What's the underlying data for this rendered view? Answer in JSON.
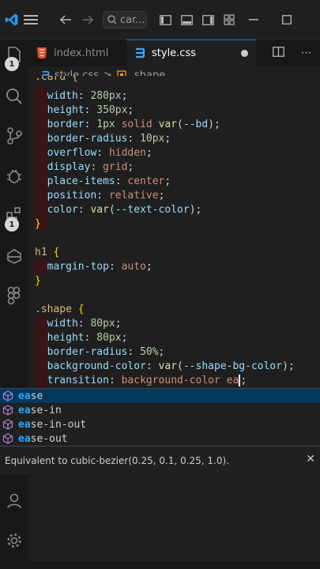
{
  "titlebar": {
    "search_placeholder": "car...",
    "icons": [
      "vscode-logo-icon",
      "menu-icon",
      "back-arrow-icon",
      "forward-arrow-icon",
      "search-icon",
      "layout-sidebar-icon",
      "layout-panel-icon",
      "layout-sidebar-right-icon",
      "layout-custom-icon",
      "minimize-icon",
      "maximize-icon"
    ]
  },
  "activity": {
    "explorer_badge": "1",
    "extensions_badge": "1"
  },
  "tabs": [
    {
      "label": "index.html",
      "icon": "html5-icon"
    },
    {
      "label": "style.css",
      "icon": "css3-icon"
    }
  ],
  "breadcrumb": {
    "file": "style.css",
    "separator": ">",
    "symbol": ".shape"
  },
  "code": {
    "top_partial": ".card {",
    "l1_prop": "width",
    "l1_val": "280px",
    "l2_prop": "height",
    "l2_val": "350px",
    "l3_prop": "border",
    "l3_val1": "1px",
    "l3_val2": "solid",
    "l3_fn": "var",
    "l3_var": "--bd",
    "l4_prop": "border-radius",
    "l4_val": "10px",
    "l5_prop": "overflow",
    "l5_val": "hidden",
    "l6_prop": "display",
    "l6_val": "grid",
    "l7_prop": "place-items",
    "l7_val": "center",
    "l8_prop": "position",
    "l8_val": "relative",
    "l9_prop": "color",
    "l9_fn": "var",
    "l9_var": "--text-color",
    "close1": "}",
    "h1_sel": "h1",
    "h1_open": "{",
    "h1_prop": "margin-top",
    "h1_val": "auto",
    "close2": "}",
    "shape_sel": ".shape",
    "shape_open": "{",
    "s1_prop": "width",
    "s1_val": "80px",
    "s2_prop": "height",
    "s2_val": "80px",
    "s3_prop": "border-radius",
    "s3_val": "50%",
    "s4_prop": "background-color",
    "s4_fn": "var",
    "s4_var": "--shape-bg-color",
    "s5_prop": "transition",
    "s5_val": "background-color",
    "s5_typed": "ea"
  },
  "suggest": {
    "items": [
      {
        "match": "ea",
        "rest": "se"
      },
      {
        "match": "ea",
        "rest": "se-in"
      },
      {
        "match": "ea",
        "rest": "se-in-out"
      },
      {
        "match": "ea",
        "rest": "se-out"
      }
    ],
    "detail": "Equivalent to cubic-bezier(0.25, 0.1, 0.25, 1.0)."
  },
  "colors": {
    "accent": "#0078d4",
    "selected_row": "#04395e",
    "match": "#2aaaff"
  }
}
